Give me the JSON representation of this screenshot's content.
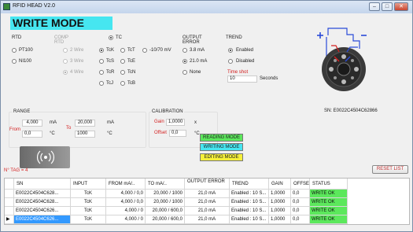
{
  "window": {
    "title": "RFID HEAD V2.0"
  },
  "heading": "WRITE MODE",
  "rtd": {
    "label": "RTD",
    "options": [
      "PT100",
      "NI100"
    ],
    "comp_label": "COMP RTD",
    "comp_options": [
      "2 Wire",
      "3 Wire",
      "4 Wire"
    ]
  },
  "tc": {
    "label": "TC",
    "options": [
      "TcK",
      "TcS",
      "TcR",
      "TcJ",
      "TcT",
      "TcE",
      "TcN",
      "TcB"
    ],
    "mv_option": "-10/70 mV"
  },
  "output_error": {
    "label": "OUTPUT ERROR",
    "options": [
      "3.8 mA",
      "21.0 mA",
      "None"
    ]
  },
  "trend": {
    "label": "TREND",
    "options": [
      "Enabled",
      "Disabled"
    ],
    "time_shot_label": "Time shot",
    "time_shot_value": "10",
    "time_shot_unit": "Seconds"
  },
  "sensor": {
    "sn_text": "SN: E0022C4504C62866"
  },
  "range": {
    "label": "RANGE",
    "from_label": "From",
    "to_label": "To",
    "from_ma": "4,000",
    "from_c": "0,0",
    "to_ma": "20,000",
    "to_c": "1000",
    "unit_ma": "mA",
    "unit_c": "°C"
  },
  "calibration": {
    "label": "CALIBRATION",
    "gain_label": "Gain",
    "gain_value": "1,0000",
    "gain_unit": "x",
    "offset_label": "Offset",
    "offset_value": "0,0",
    "offset_unit": "°C"
  },
  "modes": {
    "reading": "READING MODE",
    "writing": "WRITING MODE",
    "editing": "EDITING MODE"
  },
  "tag_count": "N° TAG = 4",
  "reset_label": "RESET LIST",
  "table": {
    "headers": [
      "SN",
      "INPUT",
      "FROM mA/..",
      "TO mA/..",
      "OUTPUT ERROR",
      "TREND",
      "GAIN",
      "OFFSET",
      "STATUS"
    ],
    "rows": [
      [
        "E0022C4504C628...",
        "TcK",
        "4,000 / 0,0",
        "20,000 / 1000",
        "21,0 mA",
        "Enabled : 10 S...",
        "1,0000",
        "0,0",
        "WRITE OK"
      ],
      [
        "E0022C4504C628...",
        "TcK",
        "4,000 / 0,0",
        "20,000 / 1000",
        "21,0 mA",
        "Enabled : 10 S...",
        "1,0000",
        "0,0",
        "WRITE OK"
      ],
      [
        "E0022C4504C626...",
        "TcK",
        "4,000 / 0",
        "20,000 / 600,0",
        "21,0 mA",
        "Enabled : 10 S...",
        "1,0000",
        "0,0",
        "WRITE OK"
      ],
      [
        "E0022C4504C626...",
        "TcK",
        "4,000 / 0",
        "20,000 / 600,0",
        "21,0 mA",
        "Enabled : 10 S...",
        "1,0000",
        "0,0",
        "WRITE OK"
      ]
    ]
  },
  "colors": {
    "heading_bg": "#46e6f0",
    "status_ok": "#5ce85c",
    "reading_btn": "#5ce85c",
    "writing_btn": "#46e6f0",
    "editing_btn": "#f5f03a"
  }
}
